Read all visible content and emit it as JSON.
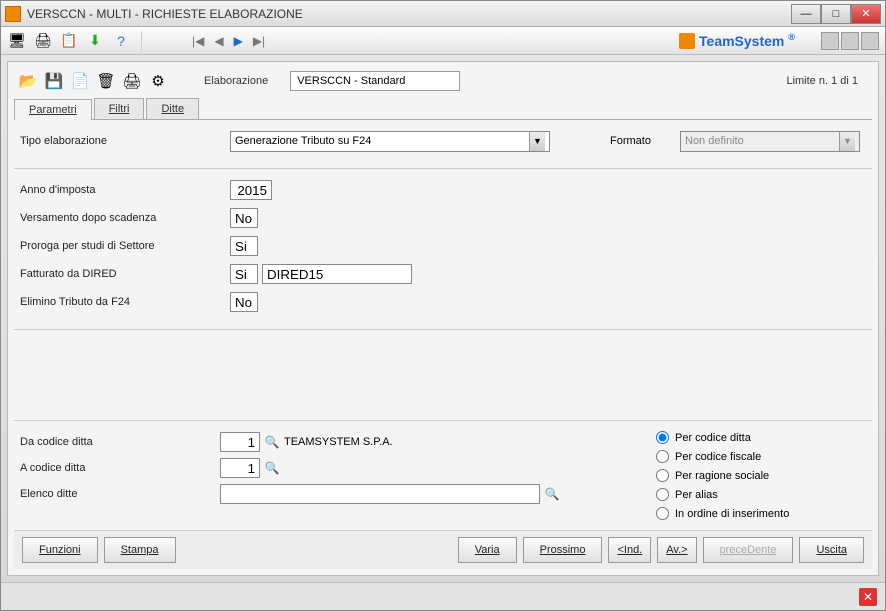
{
  "window": {
    "title": "VERSCCN  - MULTI -   RICHIESTE ELABORAZIONE"
  },
  "brand": "TeamSystem",
  "brand_reg": "®",
  "toolbar2": {
    "elab_label": "Elaborazione",
    "elab_value": "VERSCCN - Standard",
    "limite": "Limite n. 1 di 1"
  },
  "tabs": {
    "parametri": "Parametri",
    "filtri": "Filtri",
    "ditte": "Ditte"
  },
  "form": {
    "tipo_elab_label": "Tipo elaborazione",
    "tipo_elab_value": "Generazione Tributo su F24",
    "formato_label": "Formato",
    "formato_value": "Non definito",
    "anno_label": "Anno d'imposta",
    "anno_value": "2015",
    "versamento_label": "Versamento dopo scadenza",
    "versamento_value": "No",
    "proroga_label": "Proroga per studi di Settore",
    "proroga_value": "Si",
    "fatturato_label": "Fatturato da DIRED",
    "fatturato_value": "Si",
    "fatturato_text": "DIRED15",
    "elimino_label": "Elimino Tributo da F24",
    "elimino_value": "No"
  },
  "lower": {
    "da_codice_label": "Da codice ditta",
    "da_codice_value": "1",
    "da_codice_name": "TEAMSYSTEM S.P.A.",
    "a_codice_label": "A codice ditta",
    "a_codice_value": "1",
    "elenco_label": "Elenco ditte",
    "elenco_value": ""
  },
  "radios": {
    "r1": "Per codice ditta",
    "r2": "Per codice fiscale",
    "r3": "Per ragione sociale",
    "r4": "Per alias",
    "r5": "In ordine di inserimento"
  },
  "buttons": {
    "funzioni": "Funzioni",
    "stampa": "Stampa",
    "varia": "Varia",
    "prossimo": "Prossimo",
    "ind": "<Ind.",
    "av": "Av.>",
    "precedente": "preceDente",
    "uscita": "Uscita"
  }
}
